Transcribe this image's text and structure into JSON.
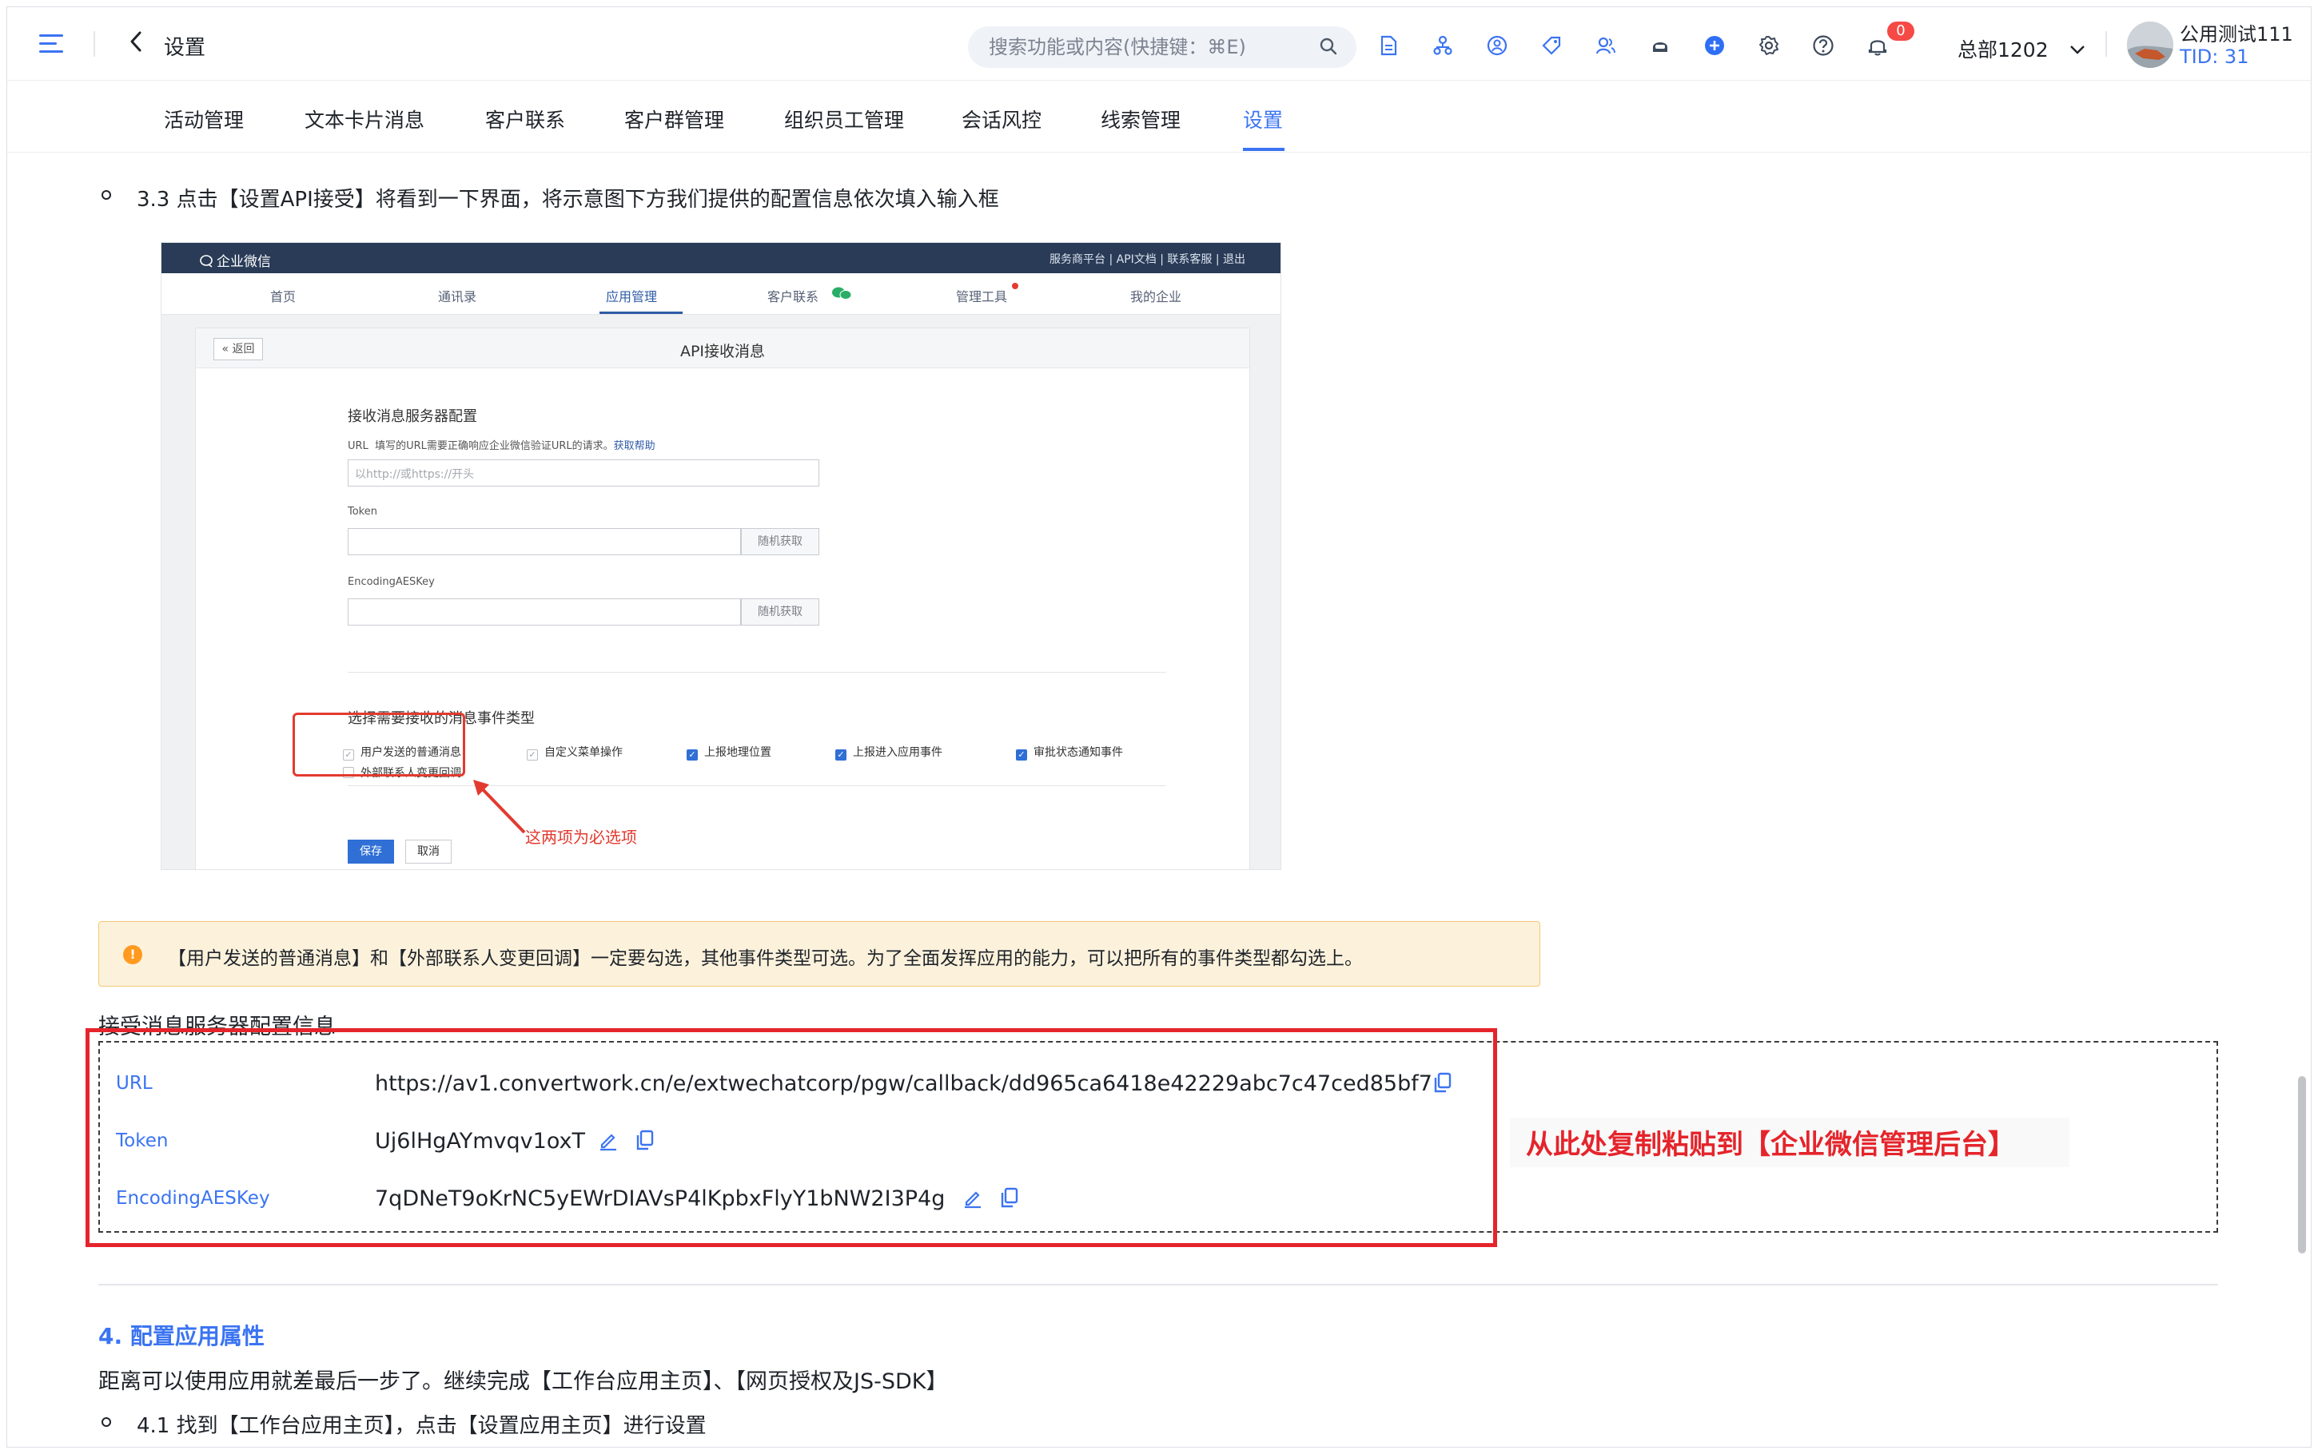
{
  "topbar": {
    "title": "设置",
    "search_placeholder": "搜索功能或内容(快捷键：⌘E)",
    "notification_count": "0",
    "org_name": "总部1202",
    "account_name": "公用测试111",
    "tid": "TID: 31",
    "icons": [
      "file-icon",
      "org-icon",
      "compass-icon",
      "tag-icon",
      "users-icon",
      "robot-icon",
      "plus-circle-icon",
      "gear-icon",
      "help-icon",
      "bell-icon"
    ]
  },
  "nav": {
    "items": [
      "活动管理",
      "文本卡片消息",
      "客户联系",
      "客户群管理",
      "组织员工管理",
      "会话风控",
      "线索管理",
      "设置"
    ],
    "active": "设置"
  },
  "content": {
    "step_3_3": "3.3 点击【设置API接受】将看到一下界面，将示意图下方我们提供的配置信息依次填入输入框",
    "screenshot": {
      "brand": "企业微信",
      "top_links": "服务商平台 | API文档 | 联系客服 | 退出",
      "tabs": [
        "首页",
        "通讯录",
        "应用管理",
        "客户联系",
        "管理工具",
        "我的企业"
      ],
      "active_tab": "应用管理",
      "back": "« 返回",
      "title": "API接收消息",
      "server_config": "接收消息服务器配置",
      "url_label": "URL",
      "url_hint": "填写的URL需要正确响应企业微信验证URL的请求。",
      "url_help": "获取帮助",
      "url_placeholder": "以http://或https://开头",
      "token_label": "Token",
      "aeskey_label": "EncodingAESKey",
      "random_btn": "随机获取",
      "events_title": "选择需要接收的消息事件类型",
      "events": [
        {
          "label": "用户发送的普通消息",
          "checked": true
        },
        {
          "label": "外部联系人变更回调",
          "checked": false
        },
        {
          "label": "自定义菜单操作",
          "checked": true
        },
        {
          "label": "上报地理位置",
          "checked": true
        },
        {
          "label": "上报进入应用事件",
          "checked": true
        },
        {
          "label": "审批状态通知事件",
          "checked": true
        }
      ],
      "required_note": "这两项为必选项",
      "save": "保存",
      "cancel": "取消"
    },
    "alert": "【用户发送的普通消息】和【外部联系人变更回调】一定要勾选，其他事件类型可选。为了全面发挥应用的能力，可以把所有的事件类型都勾选上。",
    "config_title": "接受消息服务器配置信息",
    "config": {
      "url_label": "URL",
      "url_value": "https://av1.convertwork.cn/e/extwechatcorp/pgw/callback/dd965ca6418e42229abc7c47ced85bf7",
      "token_label": "Token",
      "token_value": "Uj6lHgAYmvqv1oxT",
      "aes_label": "EncodingAESKey",
      "aes_value": "7qDNeT9oKrNC5yEWrDIAVsP4lKpbxFlyY1bNW2I3P4g"
    },
    "copy_callout": "从此处复制粘贴到【企业微信管理后台】",
    "section4_title": "4. 配置应用属性",
    "section4_text": "距离可以使用应用就差最后一步了。继续完成【工作台应用主页】、【网页授权及JS-SDK】",
    "step_4_1": "4.1 找到【工作台应用主页】，点击【设置应用主页】进行设置"
  },
  "colors": {
    "accent": "#3b74f2",
    "highlight_red": "#e5242b",
    "alert_bg": "#fcf2dc",
    "alert_border": "#f3c873"
  }
}
